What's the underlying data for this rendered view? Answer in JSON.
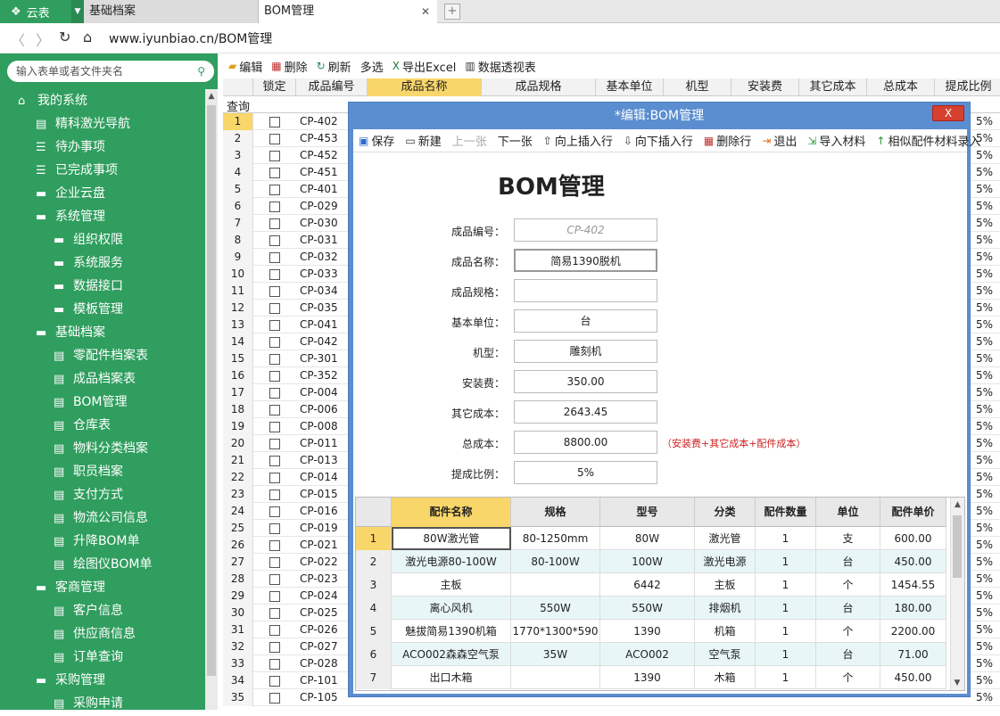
{
  "app": {
    "name": "云表"
  },
  "tabs": [
    {
      "label": "基础档案"
    },
    {
      "label": "BOM管理"
    }
  ],
  "address": {
    "url": "www.iyunbiao.cn/BOM管理"
  },
  "sidebar": {
    "search_placeholder": "输入表单或者文件夹名",
    "items": [
      {
        "label": "我的系统",
        "icon": "home-icon",
        "level": 0
      },
      {
        "label": "精科激光导航",
        "icon": "form-icon",
        "level": 1
      },
      {
        "label": "待办事项",
        "icon": "list-icon",
        "level": 1
      },
      {
        "label": "已完成事项",
        "icon": "list-icon",
        "level": 1
      },
      {
        "label": "企业云盘",
        "icon": "folder-icon",
        "level": 1
      },
      {
        "label": "系统管理",
        "icon": "folder-icon",
        "level": 1
      },
      {
        "label": "组织权限",
        "icon": "folder-icon",
        "level": 2
      },
      {
        "label": "系统服务",
        "icon": "folder-icon",
        "level": 2
      },
      {
        "label": "数据接口",
        "icon": "folder-icon",
        "level": 2
      },
      {
        "label": "模板管理",
        "icon": "folder-icon",
        "level": 2
      },
      {
        "label": "基础档案",
        "icon": "folder-icon",
        "level": 1
      },
      {
        "label": "零配件档案表",
        "icon": "form-icon",
        "level": 2
      },
      {
        "label": "成品档案表",
        "icon": "form-icon",
        "level": 2
      },
      {
        "label": "BOM管理",
        "icon": "form-icon",
        "level": 2
      },
      {
        "label": "仓库表",
        "icon": "form-icon",
        "level": 2
      },
      {
        "label": "物料分类档案",
        "icon": "form-icon",
        "level": 2
      },
      {
        "label": "职员档案",
        "icon": "form-icon",
        "level": 2
      },
      {
        "label": "支付方式",
        "icon": "form-icon",
        "level": 2
      },
      {
        "label": "物流公司信息",
        "icon": "form-icon",
        "level": 2
      },
      {
        "label": "升降BOM单",
        "icon": "form-icon",
        "level": 2
      },
      {
        "label": "绘图仪BOM单",
        "icon": "form-icon",
        "level": 2
      },
      {
        "label": "客商管理",
        "icon": "folder-icon",
        "level": 1
      },
      {
        "label": "客户信息",
        "icon": "form-icon",
        "level": 2
      },
      {
        "label": "供应商信息",
        "icon": "form-icon",
        "level": 2
      },
      {
        "label": "订单查询",
        "icon": "form-icon",
        "level": 2
      },
      {
        "label": "采购管理",
        "icon": "folder-icon",
        "level": 1
      },
      {
        "label": "采购申请",
        "icon": "form-icon",
        "level": 2
      }
    ]
  },
  "main_toolbar": [
    {
      "label": "编辑",
      "icon": "folder-open-icon"
    },
    {
      "label": "删除",
      "icon": "grid-delete-icon"
    },
    {
      "label": "刷新",
      "icon": "refresh-icon"
    },
    {
      "label": "多选",
      "icon": ""
    },
    {
      "label": "导出Excel",
      "icon": "excel-icon"
    },
    {
      "label": "数据透视表",
      "icon": "pivot-icon"
    }
  ],
  "grid": {
    "columns": [
      "锁定",
      "成品编号",
      "成品名称",
      "成品规格",
      "基本单位",
      "机型",
      "安装费",
      "其它成本",
      "总成本",
      "提成比例"
    ],
    "query_label": "查询",
    "rows": [
      {
        "n": "1",
        "code": "CP-402",
        "pct": "5%"
      },
      {
        "n": "2",
        "code": "CP-453",
        "pct": "5%"
      },
      {
        "n": "3",
        "code": "CP-452",
        "pct": "5%"
      },
      {
        "n": "4",
        "code": "CP-451",
        "pct": "5%"
      },
      {
        "n": "5",
        "code": "CP-401",
        "pct": "5%"
      },
      {
        "n": "6",
        "code": "CP-029",
        "pct": "5%"
      },
      {
        "n": "7",
        "code": "CP-030",
        "pct": "5%"
      },
      {
        "n": "8",
        "code": "CP-031",
        "pct": "5%"
      },
      {
        "n": "9",
        "code": "CP-032",
        "pct": "5%"
      },
      {
        "n": "10",
        "code": "CP-033",
        "pct": "5%"
      },
      {
        "n": "11",
        "code": "CP-034",
        "pct": "5%"
      },
      {
        "n": "12",
        "code": "CP-035",
        "pct": "5%"
      },
      {
        "n": "13",
        "code": "CP-041",
        "pct": "5%"
      },
      {
        "n": "14",
        "code": "CP-042",
        "pct": "5%"
      },
      {
        "n": "15",
        "code": "CP-301",
        "pct": "5%"
      },
      {
        "n": "16",
        "code": "CP-352",
        "pct": "5%"
      },
      {
        "n": "17",
        "code": "CP-004",
        "pct": "5%"
      },
      {
        "n": "18",
        "code": "CP-006",
        "pct": "5%"
      },
      {
        "n": "19",
        "code": "CP-008",
        "pct": "5%"
      },
      {
        "n": "20",
        "code": "CP-011",
        "pct": "5%"
      },
      {
        "n": "21",
        "code": "CP-013",
        "pct": "5%"
      },
      {
        "n": "22",
        "code": "CP-014",
        "pct": "5%"
      },
      {
        "n": "23",
        "code": "CP-015",
        "pct": "5%"
      },
      {
        "n": "24",
        "code": "CP-016",
        "pct": "5%"
      },
      {
        "n": "25",
        "code": "CP-019",
        "pct": "5%"
      },
      {
        "n": "26",
        "code": "CP-021",
        "pct": "5%"
      },
      {
        "n": "27",
        "code": "CP-022",
        "pct": "5%"
      },
      {
        "n": "28",
        "code": "CP-023",
        "pct": "5%"
      },
      {
        "n": "29",
        "code": "CP-024",
        "pct": "5%"
      },
      {
        "n": "30",
        "code": "CP-025",
        "pct": "5%"
      },
      {
        "n": "31",
        "code": "CP-026",
        "pct": "5%"
      },
      {
        "n": "32",
        "code": "CP-027",
        "pct": "5%"
      },
      {
        "n": "33",
        "code": "CP-028",
        "pct": "5%"
      },
      {
        "n": "34",
        "code": "CP-101",
        "pct": "5%"
      },
      {
        "n": "35",
        "code": "CP-105",
        "pct": "5%"
      }
    ]
  },
  "dialog": {
    "title": "*编辑:BOM管理",
    "close_label": "X",
    "toolbar": [
      {
        "label": "保存",
        "icon": "save-icon",
        "enabled": true
      },
      {
        "label": "新建",
        "icon": "new-icon",
        "enabled": true
      },
      {
        "label": "上一张",
        "icon": "",
        "enabled": false
      },
      {
        "label": "下一张",
        "icon": "",
        "enabled": true
      },
      {
        "label": "向上插入行",
        "icon": "insert-up-icon",
        "enabled": true
      },
      {
        "label": "向下插入行",
        "icon": "insert-down-icon",
        "enabled": true
      },
      {
        "label": "删除行",
        "icon": "delete-row-icon",
        "enabled": true
      },
      {
        "label": "退出",
        "icon": "exit-icon",
        "enabled": true
      },
      {
        "label": "导入材料",
        "icon": "import-icon",
        "enabled": true
      },
      {
        "label": "相似配件材料录入",
        "icon": "up-arrow-icon",
        "enabled": true
      }
    ],
    "form_title": "BOM管理",
    "fields": [
      {
        "label": "成品编号：",
        "value": "CP-402",
        "placeholder": true
      },
      {
        "label": "成品名称：",
        "value": "简易1390脱机",
        "active": true
      },
      {
        "label": "成品规格：",
        "value": ""
      },
      {
        "label": "基本单位：",
        "value": "台"
      },
      {
        "label": "机型：",
        "value": "雕刻机"
      },
      {
        "label": "安装费：",
        "value": "350.00"
      },
      {
        "label": "其它成本：",
        "value": "2643.45"
      },
      {
        "label": "总成本：",
        "value": "8800.00"
      },
      {
        "label": "提成比例：",
        "value": "5%"
      }
    ],
    "total_note": "（安装费+其它成本+配件成本）",
    "sub_columns": [
      "配件名称",
      "规格",
      "型号",
      "分类",
      "配件数量",
      "单位",
      "配件单价"
    ],
    "sub_rows": [
      {
        "n": "1",
        "name": "80W激光管",
        "spec": "80-1250mm",
        "model": "80W",
        "cat": "激光管",
        "qty": "1",
        "unit": "支",
        "price": "600.00"
      },
      {
        "n": "2",
        "name": "激光电源80-100W",
        "spec": "80-100W",
        "model": "100W",
        "cat": "激光电源",
        "qty": "1",
        "unit": "台",
        "price": "450.00"
      },
      {
        "n": "3",
        "name": "主板",
        "spec": "",
        "model": "6442",
        "cat": "主板",
        "qty": "1",
        "unit": "个",
        "price": "1454.55"
      },
      {
        "n": "4",
        "name": "离心风机",
        "spec": "550W",
        "model": "550W",
        "cat": "排烟机",
        "qty": "1",
        "unit": "台",
        "price": "180.00"
      },
      {
        "n": "5",
        "name": "魅拔简易1390机箱",
        "spec": "1770*1300*590",
        "model": "1390",
        "cat": "机箱",
        "qty": "1",
        "unit": "个",
        "price": "2200.00"
      },
      {
        "n": "6",
        "name": "ACO002森森空气泵",
        "spec": "35W",
        "model": "ACO002",
        "cat": "空气泵",
        "qty": "1",
        "unit": "台",
        "price": "71.00"
      },
      {
        "n": "7",
        "name": "出口木箱",
        "spec": "",
        "model": "1390",
        "cat": "木箱",
        "qty": "1",
        "unit": "个",
        "price": "450.00"
      }
    ]
  },
  "colors": {
    "brand": "#2f9e5e",
    "selected": "#f9d66a",
    "dialog": "#5b8ed0",
    "note": "#d02020"
  }
}
